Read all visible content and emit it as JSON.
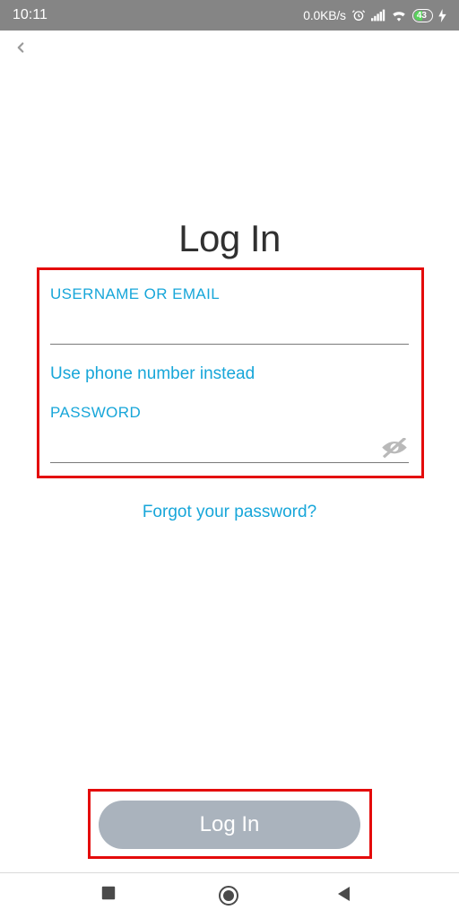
{
  "status": {
    "time": "10:11",
    "data_rate": "0.0KB/s",
    "battery_pct": "43"
  },
  "page": {
    "title": "Log In"
  },
  "form": {
    "username_label": "USERNAME OR EMAIL",
    "username_value": "",
    "switch_to_phone": "Use phone number instead",
    "password_label": "PASSWORD",
    "password_value": ""
  },
  "links": {
    "forgot": "Forgot your password?"
  },
  "buttons": {
    "login": "Log In"
  }
}
